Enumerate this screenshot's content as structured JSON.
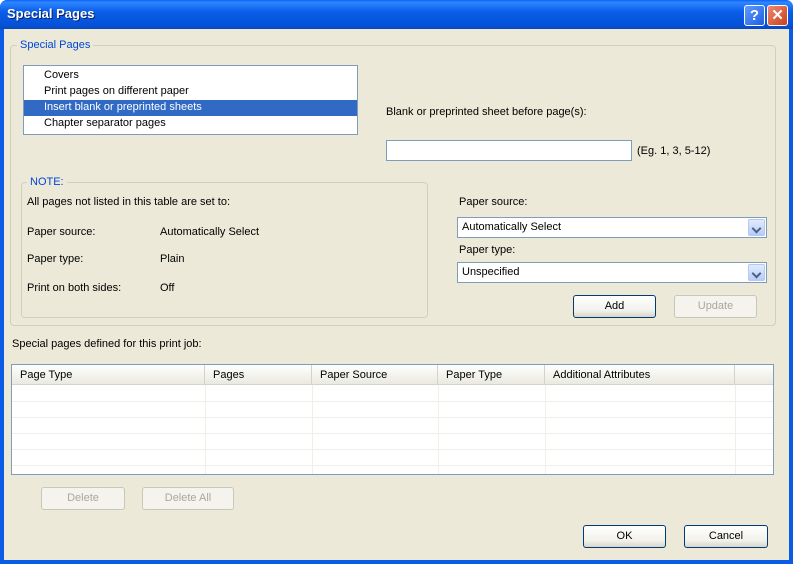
{
  "window": {
    "title": "Special Pages",
    "help_glyph": "?",
    "close_glyph": "✕"
  },
  "special_pages_group": {
    "legend": "Special Pages",
    "list_items": [
      {
        "label": "Covers",
        "selected": false
      },
      {
        "label": "Print pages on different paper",
        "selected": false
      },
      {
        "label": "Insert blank or preprinted sheets",
        "selected": true
      },
      {
        "label": "Chapter separator pages",
        "selected": false
      }
    ],
    "blank_sheet_label": "Blank or preprinted sheet before page(s):",
    "pages_input_value": "",
    "pages_hint": "(Eg. 1, 3, 5-12)",
    "paper_source_label": "Paper source:",
    "paper_source_value": "Automatically Select",
    "paper_type_label": "Paper type:",
    "paper_type_value": "Unspecified",
    "add_label": "Add",
    "update_label": "Update"
  },
  "note_group": {
    "legend": "NOTE:",
    "intro": "All pages not listed in this table are set to:",
    "rows": [
      {
        "label": "Paper source:",
        "value": "Automatically Select"
      },
      {
        "label": "Paper type:",
        "value": "Plain"
      },
      {
        "label": "Print on both sides:",
        "value": "Off"
      }
    ]
  },
  "defined_pages": {
    "label": "Special pages defined for this print job:",
    "columns": [
      "Page Type",
      "Pages",
      "Paper Source",
      "Paper Type",
      "Additional Attributes"
    ],
    "rows": []
  },
  "buttons": {
    "delete": "Delete",
    "delete_all": "Delete All",
    "ok": "OK",
    "cancel": "Cancel"
  },
  "colors": {
    "title_bar": "#0a5ce6",
    "dialog_bg": "#ece9d8",
    "selection": "#316ac5",
    "group_legend": "#0046d5"
  }
}
